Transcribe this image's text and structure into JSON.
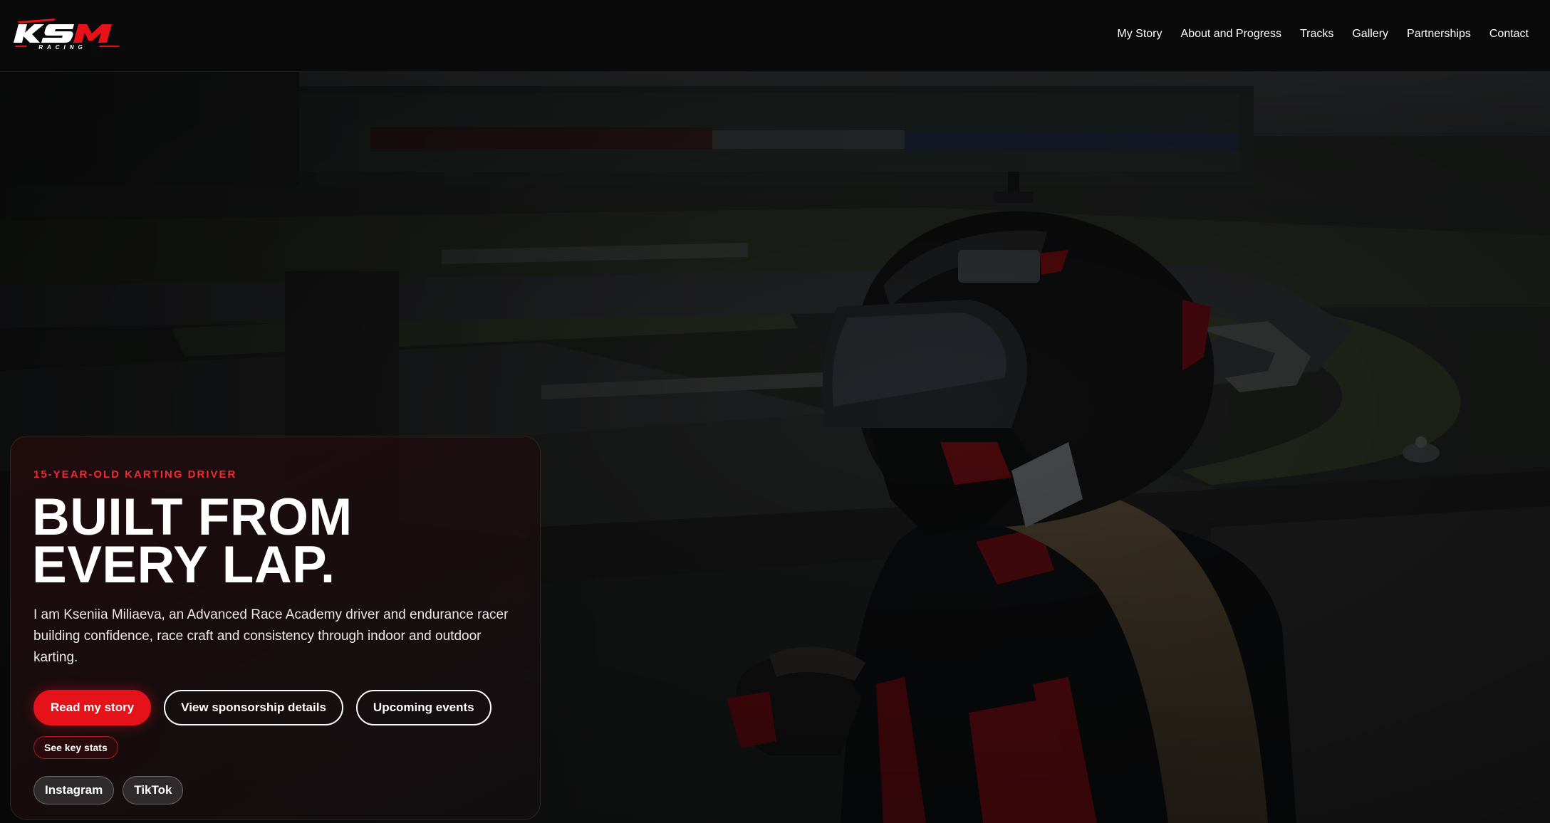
{
  "brand": {
    "logo_text": "KSM",
    "logo_subtext": "RACING",
    "accent_color": "#e5121a"
  },
  "nav": {
    "items": [
      {
        "label": "My Story"
      },
      {
        "label": "About and Progress"
      },
      {
        "label": "Tracks"
      },
      {
        "label": "Gallery"
      },
      {
        "label": "Partnerships"
      },
      {
        "label": "Contact"
      }
    ]
  },
  "hero": {
    "background_image": "helmeted-driver-overlooking-kart-track",
    "eyebrow": "15-YEAR-OLD KARTING DRIVER",
    "headline_line1": "BUILT FROM",
    "headline_line2": "EVERY LAP.",
    "intro": "I am Kseniia Miliaeva, an Advanced Race Academy driver and endurance racer building confidence, race craft and consistency through indoor and outdoor karting.",
    "buttons": {
      "primary": "Read my story",
      "sponsorship": "View sponsorship details",
      "events": "Upcoming events"
    },
    "key_stats_label": "See key stats",
    "social": {
      "instagram": "Instagram",
      "tiktok": "TikTok"
    }
  }
}
